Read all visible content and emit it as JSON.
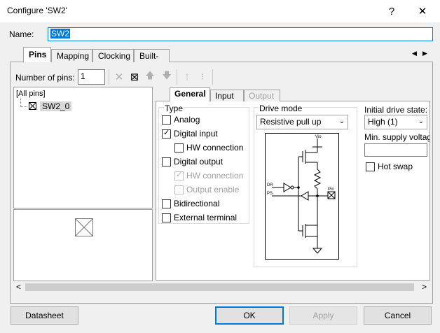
{
  "window": {
    "title": "Configure 'SW2'",
    "help_label": "?",
    "close_label": "✕"
  },
  "name": {
    "label": "Name:",
    "value": "SW2"
  },
  "tabs": [
    {
      "label": "Pins"
    },
    {
      "label": "Mapping"
    },
    {
      "label": "Clocking"
    },
    {
      "label": "Built-in"
    }
  ],
  "tab_scroll": {
    "left": "◀",
    "right": "▶"
  },
  "pins": {
    "num_label": "Number of pins:",
    "num_value": "1",
    "toolbar": {
      "delete": "✕",
      "copy": "⊠",
      "up": "🡅",
      "down": "🡇",
      "split": "⁞",
      "join": "⁝"
    },
    "tree": {
      "root": "[All pins]",
      "item": "SW2_0"
    }
  },
  "inner_tabs": [
    {
      "label": "General"
    },
    {
      "label": "Input"
    },
    {
      "label": "Output"
    }
  ],
  "type_group": {
    "title": "Type",
    "options": [
      {
        "label": "Analog",
        "checked": false
      },
      {
        "label": "Digital input",
        "checked": true
      },
      {
        "label": "HW connection",
        "checked": false
      },
      {
        "label": "Digital output",
        "checked": false
      },
      {
        "label": "HW connection",
        "checked": true
      },
      {
        "label": "Output enable",
        "checked": false
      },
      {
        "label": "Bidirectional",
        "checked": false
      },
      {
        "label": "External terminal",
        "checked": false
      }
    ]
  },
  "drive_mode": {
    "title": "Drive mode",
    "value": "Resistive pull up",
    "diagram": {
      "vio": "Vio",
      "dr": "DR",
      "ps": "PS",
      "pin": "Pin"
    }
  },
  "initial_drive": {
    "label": "Initial drive state:",
    "value": "High (1)"
  },
  "min_supply": {
    "label": "Min. supply voltage",
    "value": ""
  },
  "hot_swap": {
    "label": "Hot swap",
    "checked": false
  },
  "hscroll": {
    "left": "<",
    "right": ">"
  },
  "buttons": {
    "datasheet": "Datasheet",
    "ok": "OK",
    "apply": "Apply",
    "cancel": "Cancel"
  }
}
